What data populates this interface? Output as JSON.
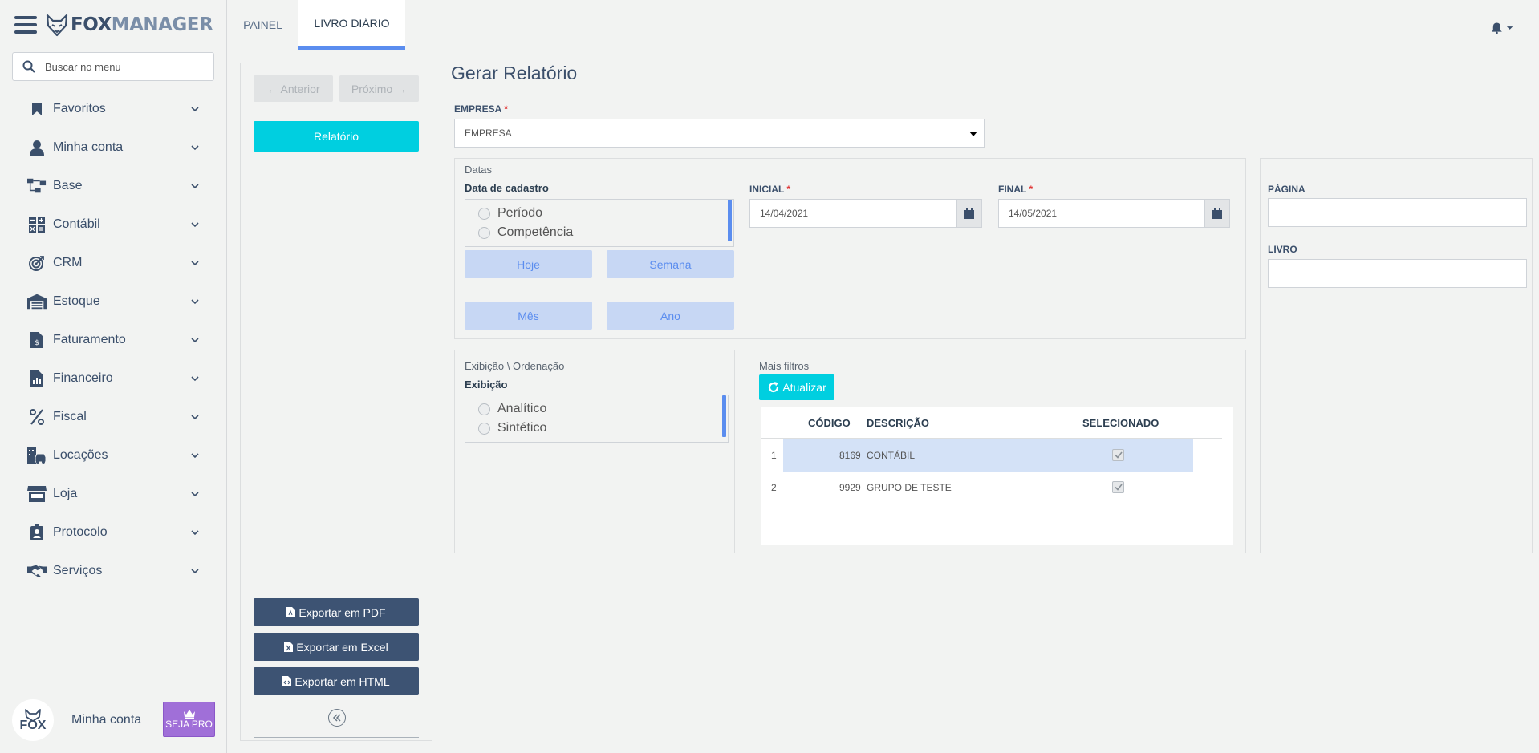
{
  "brand": {
    "name_a": "FOX",
    "name_b": "MANAGER"
  },
  "search": {
    "placeholder": "Buscar no menu"
  },
  "sidebar": {
    "items": [
      {
        "label": "Favoritos",
        "icon": "bookmark-icon"
      },
      {
        "label": "Minha conta",
        "icon": "user-icon"
      },
      {
        "label": "Base",
        "icon": "sitemap-icon"
      },
      {
        "label": "Contábil",
        "icon": "calculator-icon"
      },
      {
        "label": "CRM",
        "icon": "target-icon"
      },
      {
        "label": "Estoque",
        "icon": "warehouse-icon"
      },
      {
        "label": "Faturamento",
        "icon": "invoice-icon"
      },
      {
        "label": "Financeiro",
        "icon": "report-icon"
      },
      {
        "label": "Fiscal",
        "icon": "percent-icon"
      },
      {
        "label": "Locações",
        "icon": "building-car-icon"
      },
      {
        "label": "Loja",
        "icon": "store-icon"
      },
      {
        "label": "Protocolo",
        "icon": "badge-icon"
      },
      {
        "label": "Serviços",
        "icon": "handshake-icon"
      }
    ]
  },
  "account": {
    "avatar_text": "FOX",
    "label": "Minha conta",
    "pro_label": "SEJA PRO"
  },
  "tabs": [
    {
      "label": "PAINEL",
      "active": false
    },
    {
      "label": "LIVRO DIÁRIO",
      "active": true
    }
  ],
  "actions": {
    "prev": "← Anterior",
    "next": "Próximo →",
    "report": "Relatório",
    "export_pdf": "Exportar em PDF",
    "export_excel": "Exportar em Excel",
    "export_html": "Exportar em HTML"
  },
  "main": {
    "title": "Gerar Relatório",
    "empresa": {
      "label": "EMPRESA",
      "required": "*",
      "value": "EMPRESA"
    },
    "datas": {
      "title": "Datas",
      "subtitle": "Data de cadastro",
      "options": [
        "Período",
        "Competência"
      ],
      "quick": [
        "Hoje",
        "Semana",
        "Mês",
        "Ano"
      ],
      "inicial_label": "INICIAL",
      "inicial_value": "14/04/2021",
      "final_label": "FINAL",
      "final_value": "14/05/2021",
      "required": "*"
    },
    "pagina_label": "PÁGINA",
    "livro_label": "LIVRO",
    "exibicao": {
      "title": "Exibição \\ Ordenação",
      "subtitle": "Exibição",
      "options": [
        "Analítico",
        "Sintético"
      ]
    },
    "filtros": {
      "title": "Mais filtros",
      "refresh": "Atualizar",
      "columns": [
        "CÓDIGO",
        "DESCRIÇÃO",
        "SELECIONADO"
      ],
      "rows": [
        {
          "n": "1",
          "codigo": "8169",
          "descricao": "CONTÁBIL",
          "selecionado": true
        },
        {
          "n": "2",
          "codigo": "9929",
          "descricao": "GRUPO DE TESTE",
          "selecionado": true
        }
      ]
    }
  },
  "colors": {
    "accent": "#5b8def",
    "cyan": "#00cfe0",
    "navy": "#3d5373",
    "pro": "#a06fd8"
  }
}
